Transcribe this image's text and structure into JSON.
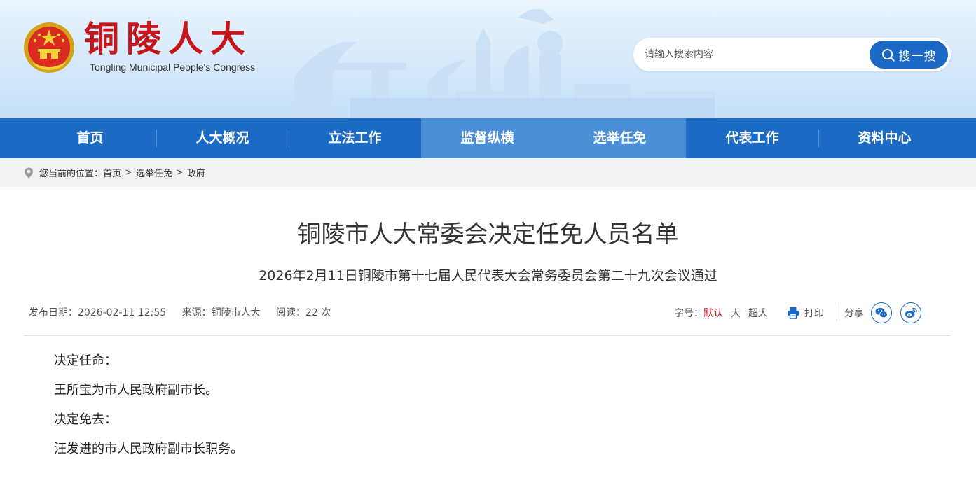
{
  "header": {
    "logo_cn": "铜陵人大",
    "logo_en": "Tongling Municipal People's Congress",
    "emblem_icon": "national-emblem-icon"
  },
  "search": {
    "placeholder": "请输入搜索内容",
    "button_label": "搜一搜",
    "icon": "search-icon"
  },
  "nav": {
    "items": [
      {
        "label": "首页"
      },
      {
        "label": "人大概况"
      },
      {
        "label": "立法工作"
      },
      {
        "label": "监督纵横"
      },
      {
        "label": "选举任免"
      },
      {
        "label": "代表工作"
      },
      {
        "label": "资料中心"
      }
    ],
    "active_index": 3
  },
  "breadcrumb": {
    "icon": "location-pin-icon",
    "prefix": "您当前的位置：",
    "items": [
      "首页",
      "选举任免",
      "政府"
    ],
    "separator": ">"
  },
  "article": {
    "title": "铜陵市人大常委会决定任免人员名单",
    "subtitle": "2026年2月11日铜陵市第十七届人民代表大会常务委员会第二十九次会议通过",
    "meta": {
      "date_label": "发布日期：",
      "date": "2026-02-11 12:55",
      "source_label": "来源：",
      "source": "铜陵市人大",
      "reads_label": "阅读：",
      "reads": "22",
      "reads_unit": "次"
    },
    "paragraphs": [
      "决定任命：",
      "王所宝为市人民政府副市长。",
      "决定免去：",
      "汪发进的市人民政府副市长职务。"
    ]
  },
  "tools": {
    "font_size_label": "字号：",
    "font_sizes": [
      "默认",
      "大",
      "超大"
    ],
    "active_font_size": "默认",
    "print_label": "打印",
    "share_label": "分享",
    "share_icons": [
      "wechat-icon",
      "weibo-icon"
    ]
  },
  "colors": {
    "brand_blue": "#1b6ac4",
    "nav_active": "#4a8ed6",
    "logo_red": "#c4161c",
    "active_font": "#c4161c"
  }
}
